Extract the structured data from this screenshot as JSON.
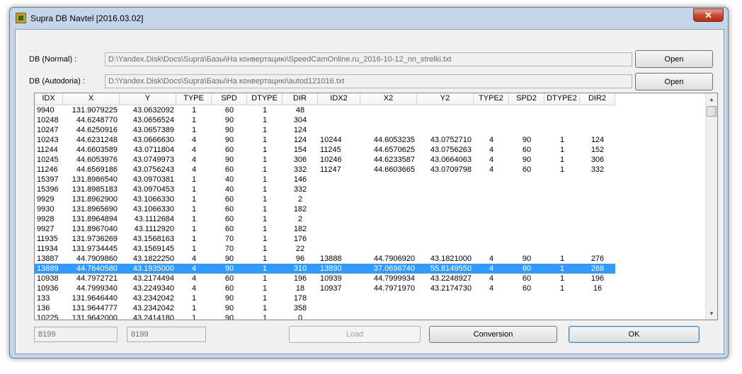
{
  "window": {
    "title": "Supra DB Navtel [2016.03.02]",
    "close_label": "✕"
  },
  "form": {
    "normal_label": "DB (Normal) :",
    "normal_path": "D:\\Yandex.Disk\\Docs\\Supra\\Базы\\На конвертацию\\SpeedCamOnline.ru_2016-10-12_nn_strelki.txt",
    "autodoria_label": "DB (Autodoria) :",
    "autodoria_path": "D:\\Yandex.Disk\\Docs\\Supra\\Базы\\На конвертацию\\autod121016.txt",
    "open_label": "Open"
  },
  "table": {
    "columns": [
      "IDX",
      "X",
      "Y",
      "TYPE",
      "SPD",
      "DTYPE",
      "DIR",
      "IDX2",
      "X2",
      "Y2",
      "TYPE2",
      "SPD2",
      "DTYPE2",
      "DIR2"
    ],
    "selected_row": 16,
    "rows": [
      [
        "9940",
        "131.9079225",
        "43.0632092",
        "1",
        "60",
        "1",
        "48",
        "",
        "",
        "",
        "",
        "",
        "",
        ""
      ],
      [
        "10248",
        "44.6248770",
        "43.0656524",
        "1",
        "90",
        "1",
        "304",
        "",
        "",
        "",
        "",
        "",
        "",
        ""
      ],
      [
        "10247",
        "44.6250916",
        "43.0657389",
        "1",
        "90",
        "1",
        "124",
        "",
        "",
        "",
        "",
        "",
        "",
        ""
      ],
      [
        "10243",
        "44.6231248",
        "43.0666630",
        "4",
        "90",
        "1",
        "124",
        "10244",
        "44.6053235",
        "43.0752710",
        "4",
        "90",
        "1",
        "124"
      ],
      [
        "11244",
        "44.6603589",
        "43.0711804",
        "4",
        "60",
        "1",
        "154",
        "11245",
        "44.6570625",
        "43.0756263",
        "4",
        "60",
        "1",
        "152"
      ],
      [
        "10245",
        "44.6053976",
        "43.0749973",
        "4",
        "90",
        "1",
        "306",
        "10246",
        "44.6233587",
        "43.0664063",
        "4",
        "90",
        "1",
        "306"
      ],
      [
        "11246",
        "44.6569186",
        "43.0756243",
        "4",
        "60",
        "1",
        "332",
        "11247",
        "44.6603665",
        "43.0709798",
        "4",
        "60",
        "1",
        "332"
      ],
      [
        "15397",
        "131.8986540",
        "43.0970381",
        "1",
        "40",
        "1",
        "146",
        "",
        "",
        "",
        "",
        "",
        "",
        ""
      ],
      [
        "15396",
        "131.8985183",
        "43.0970453",
        "1",
        "40",
        "1",
        "332",
        "",
        "",
        "",
        "",
        "",
        "",
        ""
      ],
      [
        "9929",
        "131.8962900",
        "43.1066330",
        "1",
        "60",
        "1",
        "2",
        "",
        "",
        "",
        "",
        "",
        "",
        ""
      ],
      [
        "9930",
        "131.8965690",
        "43.1066330",
        "1",
        "60",
        "1",
        "182",
        "",
        "",
        "",
        "",
        "",
        "",
        ""
      ],
      [
        "9928",
        "131.8964894",
        "43.1112684",
        "1",
        "60",
        "1",
        "2",
        "",
        "",
        "",
        "",
        "",
        "",
        ""
      ],
      [
        "9927",
        "131.8967040",
        "43.1112920",
        "1",
        "60",
        "1",
        "182",
        "",
        "",
        "",
        "",
        "",
        "",
        ""
      ],
      [
        "11935",
        "131.9736269",
        "43.1568163",
        "1",
        "70",
        "1",
        "176",
        "",
        "",
        "",
        "",
        "",
        "",
        ""
      ],
      [
        "11934",
        "131.9734445",
        "43.1569145",
        "1",
        "70",
        "1",
        "22",
        "",
        "",
        "",
        "",
        "",
        "",
        ""
      ],
      [
        "13887",
        "44.7909860",
        "43.1822250",
        "4",
        "90",
        "1",
        "96",
        "13888",
        "44.7906920",
        "43.1821000",
        "4",
        "90",
        "1",
        "276"
      ],
      [
        "13889",
        "44.7640580",
        "43.1935000",
        "4",
        "90",
        "1",
        "310",
        "13890",
        "37.0696740",
        "55.8149550",
        "4",
        "60",
        "1",
        "268"
      ],
      [
        "10938",
        "44.7972721",
        "43.2174494",
        "4",
        "60",
        "1",
        "196",
        "10939",
        "44.7999934",
        "43.2248927",
        "4",
        "60",
        "1",
        "196"
      ],
      [
        "10936",
        "44.7999340",
        "43.2249340",
        "4",
        "60",
        "1",
        "18",
        "10937",
        "44.7971970",
        "43.2174730",
        "4",
        "60",
        "1",
        "16"
      ],
      [
        "133",
        "131.9646440",
        "43.2342042",
        "1",
        "90",
        "1",
        "178",
        "",
        "",
        "",
        "",
        "",
        "",
        ""
      ],
      [
        "136",
        "131.9644777",
        "43.2342042",
        "1",
        "90",
        "1",
        "358",
        "",
        "",
        "",
        "",
        "",
        "",
        ""
      ],
      [
        "10225",
        "131.9642000",
        "43.2414180",
        "1",
        "90",
        "1",
        "0",
        "",
        "",
        "",
        "",
        "",
        "",
        ""
      ]
    ]
  },
  "footer": {
    "count1": "8199",
    "count2": "8199",
    "load_label": "Load",
    "conversion_label": "Conversion",
    "ok_label": "OK"
  }
}
